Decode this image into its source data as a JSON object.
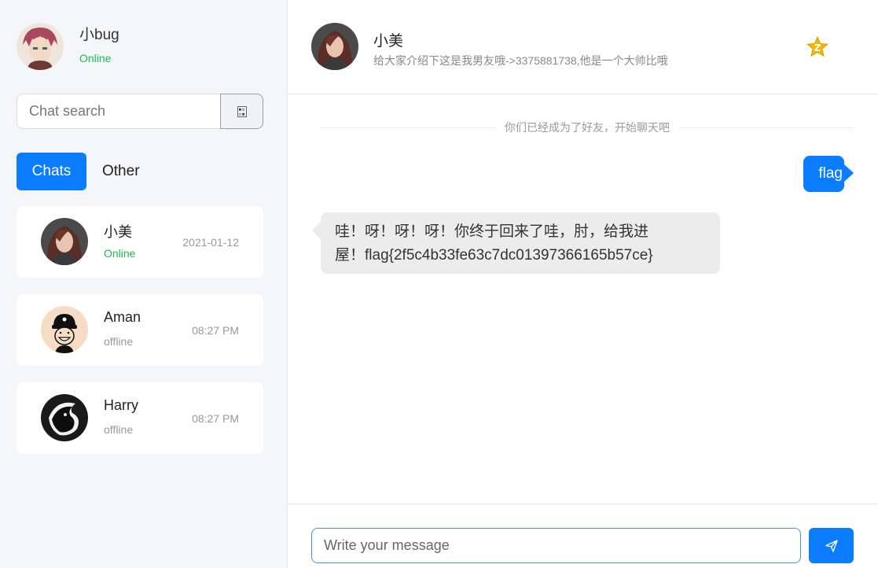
{
  "me": {
    "name": "小bug",
    "status": "Online"
  },
  "search": {
    "placeholder": "Chat search",
    "button_icon": "qr-code-icon"
  },
  "tabs": [
    {
      "label": "Chats",
      "active": true
    },
    {
      "label": "Other",
      "active": false
    }
  ],
  "chats": [
    {
      "name": "小美",
      "status": "Online",
      "time": "2021-01-12"
    },
    {
      "name": "Aman",
      "status": "offline",
      "time": "08:27 PM"
    },
    {
      "name": "Harry",
      "status": "offline",
      "time": "08:27 PM"
    }
  ],
  "header": {
    "title": "小美",
    "subtitle": "给大家介绍下这是我男友哦->3375881738,他是一个大帅比哦",
    "icon": "star-badge-icon"
  },
  "messages": {
    "system_note": "你们已经成为了好友，开始聊天吧",
    "outgoing": "flag",
    "incoming_line1": "哇！呀！呀！呀！你终于回来了哇，肘，给我进",
    "incoming_line2": "屋！flag{2f5c4b33fe63c7dc01397366165b57ce}"
  },
  "composer": {
    "placeholder": "Write your message",
    "send_icon": "paper-plane-icon"
  },
  "colors": {
    "accent": "#0a7cff",
    "online": "#1db954",
    "sidebar_bg": "#f5f6fa"
  }
}
